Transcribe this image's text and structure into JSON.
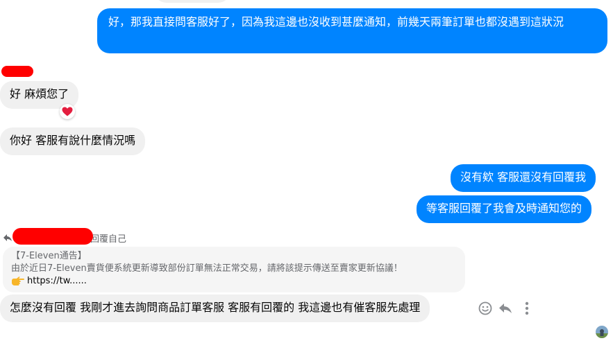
{
  "messages": {
    "out1": "好，那我直接問客服好了，因為我這邊也沒收到甚麼通知，前幾天兩筆訂單也都沒遇到這狀況",
    "in1": "好 麻煩您了",
    "in2": "你好 客服有說什麼情況嗎",
    "out2": "沒有欸 客服還沒有回覆我",
    "out3": "等客服回覆了我會及時通知您的",
    "reply_context": "回覆自己",
    "quoted_line1": "【7-Eleven通告】",
    "quoted_line2": "由於近日7-Eleven賣貨便系統更新導致部份訂單無法正常交易，請將該提示傳送至賣家更新協議！",
    "quoted_line3": "https://tw......",
    "in3": "怎麼沒有回覆 我剛才進去詢問商品訂單客服 客服有回覆的  我這邊也有催客服先處理"
  },
  "icons": {
    "reaction": "heart-icon",
    "reply_arrow": "reply-arrow-icon",
    "pointing": "pointing-right-hand-icon",
    "emoji": "smiley-icon",
    "reply": "reply-icon",
    "more": "more-vertical-icon"
  },
  "colors": {
    "outgoing_bubble": "#0084ff",
    "incoming_bubble": "#f0f0f0",
    "redaction": "#ff0000",
    "heart": "#e41e3f"
  }
}
